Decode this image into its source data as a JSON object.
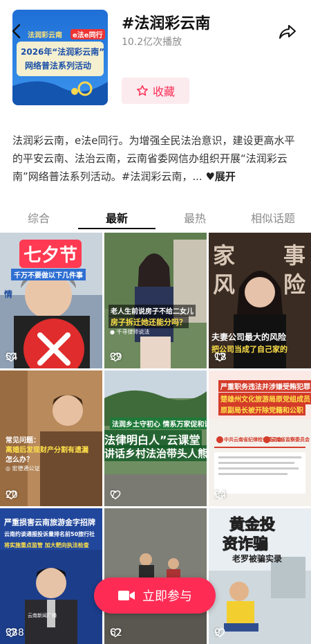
{
  "header": {
    "cover_title": "法润彩云南",
    "cover_tag": "e法e同行",
    "cover_year_line": "2026年“法润彩云南”",
    "cover_sub_line": "网络普法系列活动",
    "topic_title": "#法润彩云南",
    "plays": "10.2亿次播放",
    "favorite_label": "收藏"
  },
  "description": {
    "text": "法润彩云南，e法e同行。为增强全民法治意识，建设更高水平的平安云南、法治云南，云南省委网信办组织开展“法润彩云南”网络普法系列活动。#法润彩云南，...",
    "expand_label": "展开"
  },
  "tabs": [
    "综合",
    "最新",
    "最热",
    "相似话题"
  ],
  "active_tab": "最新",
  "videos": [
    {
      "likes": "54",
      "text1": "七夕节",
      "text2": "千万不要做以下几件事",
      "text3": "情"
    },
    {
      "likes": "39",
      "text1": "老人生前说房子不给二女儿",
      "text2": "房子拆迁她还能分吗？",
      "text3": "● 千寻律师说法"
    },
    {
      "likes": "18",
      "text1": "家",
      "text2": "事",
      "text3": "风",
      "text4": "险",
      "text5": "夫妻公司最大的风险",
      "text6": "把公司当成了自己家的"
    },
    {
      "likes": "20",
      "text1": "常见问题：",
      "text2": "离婚后发现财产分割有遗漏",
      "text3": "怎么办？",
      "text4": "◎ 宏德通公证"
    },
    {
      "likes": "7",
      "text1": "法润乡土守初心 情系万家促和谐",
      "text2": "法律明白人”云课堂",
      "text3": "讲话乡村法治带头人熊国"
    },
    {
      "likes": "34",
      "text1": "严重职务违法并涉嫌受贿犯罪",
      "text2": "楚雄州文化旅游局原党组成员",
      "text3": "原副局长被开除党籍和公职",
      "text4": "中共云南省纪律检查委员会",
      "text5": "云南省监察委员会"
    },
    {
      "likes": "388",
      "text1": "严重损害云南旅游金字招牌",
      "text2": "云南约谈通报投诉量排名前50旅行社",
      "text3": "将实施重点监管 加大靶向执法检查",
      "text4": "云南新闻广播"
    },
    {
      "likes": "62"
    },
    {
      "likes": "9",
      "text1": "黄金投",
      "text2": "资诈骗",
      "text3": "老罗被骗实录"
    }
  ],
  "cta_label": "立即参与",
  "colors": {
    "accent": "#fe2c55",
    "fav_bg": "#fbeaee"
  }
}
